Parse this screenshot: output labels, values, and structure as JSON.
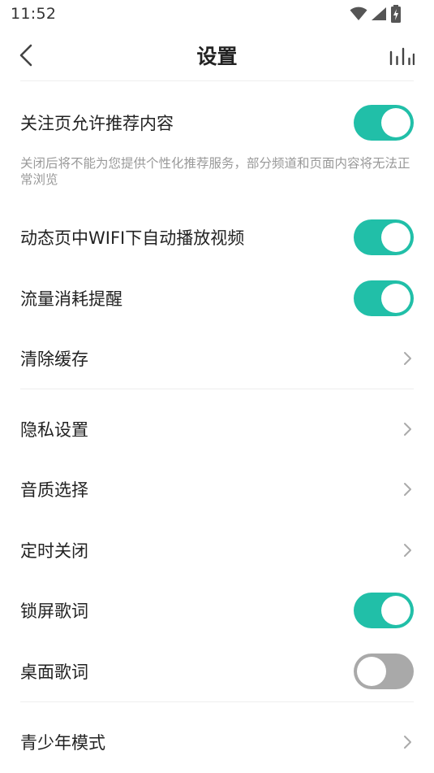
{
  "status_bar": {
    "time": "11:52",
    "icons": [
      "wifi-icon",
      "cell-signal-icon",
      "battery-charging-icon"
    ]
  },
  "header": {
    "title": "设置",
    "back_icon": "chevron-left-icon",
    "right_icon": "equalizer-icon"
  },
  "settings": {
    "recommend_on_follow": {
      "label": "关注页允许推荐内容",
      "enabled": true,
      "hint": "关闭后将不能为您提供个性化推荐服务，部分频道和页面内容将无法正常浏览"
    },
    "wifi_autoplay": {
      "label": "动态页中WIFI下自动播放视频",
      "enabled": true
    },
    "data_usage_alert": {
      "label": "流量消耗提醒",
      "enabled": true
    },
    "clear_cache": {
      "label": "清除缓存"
    },
    "privacy": {
      "label": "隐私设置"
    },
    "audio_quality": {
      "label": "音质选择"
    },
    "sleep_timer": {
      "label": "定时关闭"
    },
    "lock_screen_lyrics": {
      "label": "锁屏歌词",
      "enabled": true
    },
    "desktop_lyrics": {
      "label": "桌面歌词",
      "enabled": false
    },
    "youth_mode": {
      "label": "青少年模式"
    }
  },
  "colors": {
    "accent": "#21bfa8",
    "toggle_off": "#a9a9a9",
    "hint_text": "#999999",
    "divider": "#eeeeee"
  }
}
